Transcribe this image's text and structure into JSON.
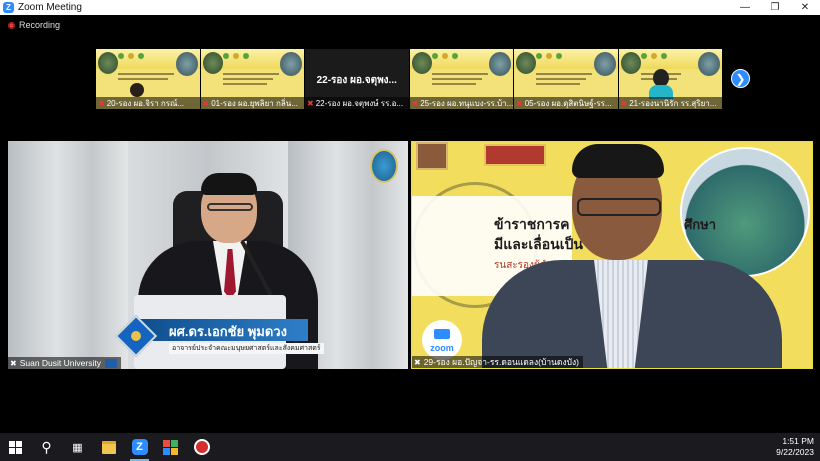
{
  "window": {
    "title": "Zoom Meeting"
  },
  "recording": {
    "label": "Recording"
  },
  "thumbnails": [
    {
      "name": "20-รอง ผอ.จิรา กรณ์...",
      "type": "slide"
    },
    {
      "name": "01-รอง ผอ.ยุพลิยา กลิ่น...",
      "type": "slide"
    },
    {
      "name": "22-รอง ผอ.จตุพงษ์ รร.อ...",
      "type": "name_only",
      "display": "22-รอง ผอ.จตุพง..."
    },
    {
      "name": "25-รอง ผอ.ทนุแบง-รร.บ้า...",
      "type": "slide"
    },
    {
      "name": "05-รอง ผอ.ดุสิตนิษฐ์-รร...",
      "type": "slide"
    },
    {
      "name": "21-รองนานิรัก รร.สุริยา...",
      "type": "slide_person"
    }
  ],
  "main_videos": {
    "left": {
      "participant_label": "Suan Dusit University",
      "lower_third_name": "ผศ.ดร.เอกชัย พุมดวง",
      "lower_third_title": "อาจารย์ประจำคณะมนุษยศาสตร์และสังคมศาสตร์"
    },
    "right": {
      "participant_label": "29-รอง ผอ.ปัญจา-รร.ดอนแดลง(บ้านดงบัง)",
      "poster_line1": "ข้าราชการค",
      "poster_line2": "มีและเลื่อนเป็น",
      "poster_line3": "รนสะรองผู้อำนว",
      "poster_line4": "ศึกษา",
      "zoom_logo_text": "zoom"
    }
  },
  "taskbar": {
    "time": "1:51 PM",
    "date": "9/22/2023"
  },
  "icons": {
    "next": "chevron-right-icon",
    "mic": "mic-muted-icon"
  },
  "colors": {
    "accent": "#2d8cff",
    "record": "#e23c3c"
  }
}
